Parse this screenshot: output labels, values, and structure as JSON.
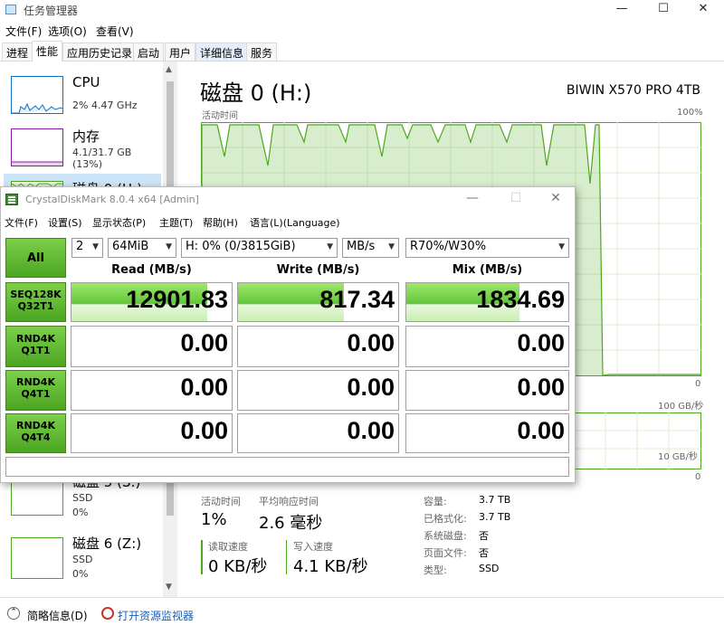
{
  "tm": {
    "title": "任务管理器",
    "window_controls": [
      "—",
      "☐",
      "✕"
    ],
    "menu": [
      "文件(F)",
      "选项(O)",
      "查看(V)"
    ],
    "tabs": [
      "进程",
      "性能",
      "应用历史记录",
      "启动",
      "用户",
      "详细信息",
      "服务"
    ],
    "sidebar": [
      {
        "name": "CPU",
        "sub1": "2% 4.47 GHz",
        "sub2": ""
      },
      {
        "name": "内存",
        "sub1": "4.1/31.7 GB (13%)",
        "sub2": ""
      },
      {
        "name": "磁盘 0 (H:)",
        "sub1": "",
        "sub2": ""
      },
      {
        "name": "磁盘 5 (S:)",
        "sub1": "SSD",
        "sub2": "0%"
      },
      {
        "name": "磁盘 6 (Z:)",
        "sub1": "SSD",
        "sub2": "0%"
      }
    ],
    "main": {
      "title": "磁盘 0 (H:)",
      "model": "BIWIN X570 PRO 4TB",
      "active_time_label": "活动时间",
      "pct_max": "100%",
      "zero": "0",
      "xfer_max": "100 GB/秒",
      "xfer_mid": "10 GB/秒"
    },
    "stats": {
      "active_time": {
        "label": "活动时间",
        "value": "1%"
      },
      "avg_response": {
        "label": "平均响应时间",
        "value": "2.6 毫秒"
      },
      "read_speed": {
        "label": "读取速度",
        "value": "0 KB/秒"
      },
      "write_speed": {
        "label": "写入速度",
        "value": "4.1 KB/秒"
      }
    },
    "props": [
      {
        "k": "容量:",
        "v": "3.7 TB"
      },
      {
        "k": "已格式化:",
        "v": "3.7 TB"
      },
      {
        "k": "系统磁盘:",
        "v": "否"
      },
      {
        "k": "页面文件:",
        "v": "否"
      },
      {
        "k": "类型:",
        "v": "SSD"
      }
    ],
    "footer": {
      "brief": "简略信息(D)",
      "resource_monitor": "打开资源监视器"
    }
  },
  "cdm": {
    "title": "CrystalDiskMark 8.0.4 x64 [Admin]",
    "menu": [
      "文件(F)",
      "设置(S)",
      "显示状态(P)",
      "主题(T)",
      "帮助(H)",
      "语言(L)(Language)"
    ],
    "all_button": "All",
    "combos": {
      "count": "2",
      "size": "64MiB",
      "drive": "H: 0% (0/3815GiB)",
      "unit": "MB/s",
      "mix": "R70%/W30%"
    },
    "headers": {
      "read": "Read (MB/s)",
      "write": "Write (MB/s)",
      "mix": "Mix (MB/s)"
    },
    "rows": [
      {
        "l1": "SEQ128K",
        "l2": "Q32T1",
        "read": "12901.83",
        "write": "817.34",
        "mix": "1834.69",
        "read_fill": 0.85,
        "write_fill": 0.66,
        "mix_fill": 0.7
      },
      {
        "l1": "RND4K",
        "l2": "Q1T1",
        "read": "0.00",
        "write": "0.00",
        "mix": "0.00",
        "read_fill": 0,
        "write_fill": 0,
        "mix_fill": 0
      },
      {
        "l1": "RND4K",
        "l2": "Q4T1",
        "read": "0.00",
        "write": "0.00",
        "mix": "0.00",
        "read_fill": 0,
        "write_fill": 0,
        "mix_fill": 0
      },
      {
        "l1": "RND4K",
        "l2": "Q4T4",
        "read": "0.00",
        "write": "0.00",
        "mix": "0.00",
        "read_fill": 0,
        "write_fill": 0,
        "mix_fill": 0
      }
    ],
    "comment": "",
    "window_controls": [
      "—",
      "☐",
      "✕"
    ]
  },
  "colors": {
    "cdm_green": "#61c53a",
    "disk_green": "#4da81e",
    "cpu_blue": "#1172c3",
    "mem_purple": "#8b18ab"
  }
}
